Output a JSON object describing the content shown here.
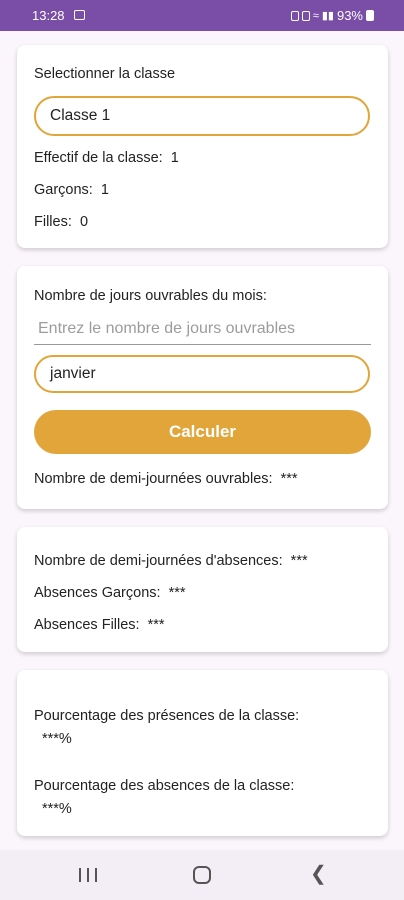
{
  "status_bar": {
    "time": "13:28",
    "battery": "93%"
  },
  "class_card": {
    "select_label": "Selectionner la classe",
    "selected_class": "Classe 1",
    "effectif_label": "Effectif de la classe:",
    "effectif_value": "1",
    "garcons_label": "Garçons:",
    "garcons_value": "1",
    "filles_label": "Filles:",
    "filles_value": "0"
  },
  "days_card": {
    "jours_label": "Nombre de jours ouvrables du mois:",
    "jours_placeholder": "Entrez le nombre de jours ouvrables",
    "month_value": "janvier",
    "calc_button": "Calculer",
    "demi_label": "Nombre de demi-journées ouvrables:",
    "demi_value": "***"
  },
  "absences_card": {
    "demi_abs_label": "Nombre de demi-journées d'absences:",
    "demi_abs_value": "***",
    "abs_garcons_label": "Absences Garçons:",
    "abs_garcons_value": "***",
    "abs_filles_label": "Absences Filles:",
    "abs_filles_value": "***"
  },
  "percent_card": {
    "presence_label": "Pourcentage des présences de la classe:",
    "presence_value": "***%",
    "absence_label": "Pourcentage des absences de la classe:",
    "absence_value": "***%"
  },
  "colors": {
    "accent": "#e2a53a",
    "status_bar": "#7a4ea6"
  }
}
